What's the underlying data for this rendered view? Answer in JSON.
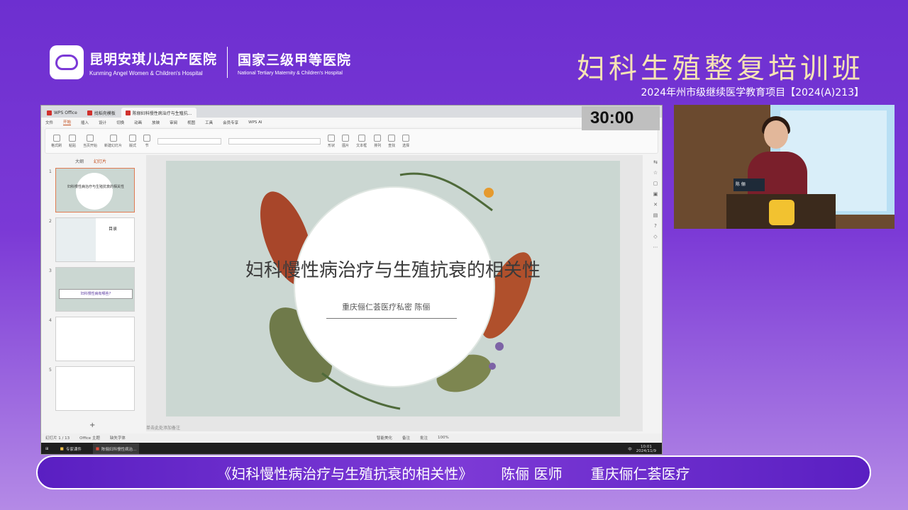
{
  "header": {
    "hospital_cn": "昆明安琪儿妇产医院",
    "hospital_en": "Kunming Angel Women & Children's Hospital",
    "rank_cn": "国家三级甲等医院",
    "rank_en": "National Tertiary Maternity & Children's Hospital",
    "course_title": "妇科生殖整复培训班",
    "course_subtitle": "2024年州市级继续医学教育项目【2024(A)213】"
  },
  "window": {
    "tabs": [
      {
        "label": "WPS Office"
      },
      {
        "label": "找稻壳模板"
      },
      {
        "label": "陈俪妇科慢性病治疗与生殖抗..."
      }
    ],
    "menu": [
      "文件",
      "开始",
      "插入",
      "设计",
      "切换",
      "动画",
      "放映",
      "审阅",
      "视图",
      "工具",
      "会员专享",
      "WPS AI"
    ],
    "active_menu": "开始",
    "ribbon": [
      "格式刷",
      "粘贴",
      "当页开始",
      "新建幻灯片",
      "版式",
      "节",
      "形状",
      "图片",
      "文本框",
      "排列",
      "查找",
      "选择"
    ],
    "timer": "30:00",
    "left_tabs": [
      "大纲",
      "幻灯片"
    ],
    "slides": [
      {
        "num": "1",
        "text": "妇科慢性病治疗与生殖抗衰的相关性"
      },
      {
        "num": "2",
        "text": "目录"
      },
      {
        "num": "3",
        "text": "妇科慢性病有哪些?"
      },
      {
        "num": "4",
        "text": ""
      },
      {
        "num": "5",
        "text": ""
      }
    ],
    "add_slide": "+",
    "slide_title": "妇科慢性病治疗与生殖抗衰的相关性",
    "slide_author": "重庆俪仁荟医疗私密   陈俪",
    "notes_placeholder": "单击此处添加备注",
    "status": [
      "幻灯片 1 / 13",
      "Office 主题",
      "缺失字体",
      "智能美化",
      "备注",
      "批注",
      "100%"
    ],
    "taskbar": {
      "items": [
        "专家课件",
        "陈俪妇科慢性病治..."
      ],
      "time": "10:01",
      "date": "2024/11/9",
      "ime": "中"
    }
  },
  "video": {
    "nameplate": "陈 俪"
  },
  "lower_third": {
    "talk_title": "《妇科慢性病治疗与生殖抗衰的相关性》",
    "speaker": "陈俪  医师",
    "org": "重庆俪仁荟医疗"
  }
}
